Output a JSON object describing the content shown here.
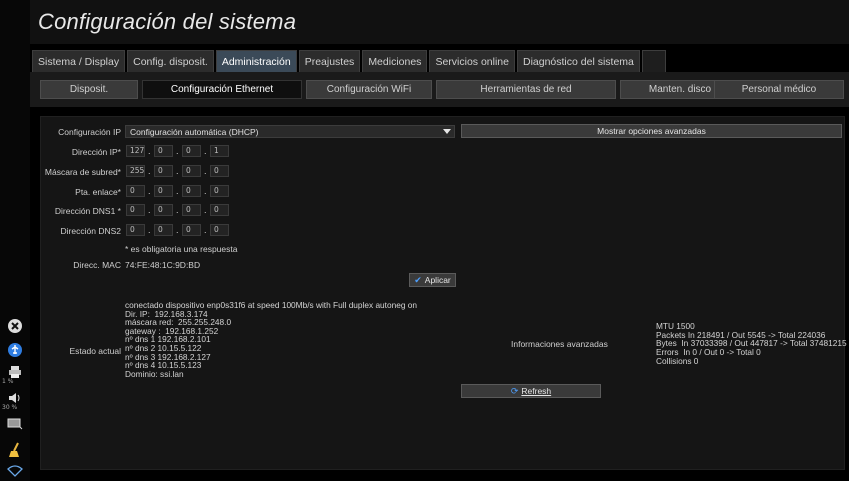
{
  "app": {
    "title": "Configuración del sistema"
  },
  "top_tabs": [
    {
      "label": "Sistema / Display",
      "active": false
    },
    {
      "label": "Config. disposit.",
      "active": false
    },
    {
      "label": "Administración",
      "active": true
    },
    {
      "label": "Preajustes",
      "active": false
    },
    {
      "label": "Mediciones",
      "active": false
    },
    {
      "label": "Servicios online",
      "active": false
    },
    {
      "label": "Diagnóstico del sistema",
      "active": false
    }
  ],
  "sub_tabs": [
    {
      "label": "Disposit.",
      "active": false
    },
    {
      "label": "Configuración Ethernet",
      "active": true
    },
    {
      "label": "Configuración WiFi",
      "active": false
    },
    {
      "label": "Herramientas de red",
      "active": false
    },
    {
      "label": "Manten. disco",
      "active": false
    },
    {
      "label": "Personal médico",
      "active": false
    }
  ],
  "form": {
    "ip_config_label": "Configuración IP",
    "ip_config_value": "Configuración automática (DHCP)",
    "advanced_button": "Mostrar opciones avanzadas",
    "ip_address_label": "Dirección IP*",
    "ip_address": [
      "127",
      "0",
      "0",
      "1"
    ],
    "subnet_label": "Máscara de subred*",
    "subnet": [
      "255",
      "0",
      "0",
      "0"
    ],
    "gateway_label": "Pta. enlace*",
    "gateway": [
      "0",
      "0",
      "0",
      "0"
    ],
    "dns1_label": "Dirección DNS1 *",
    "dns1": [
      "0",
      "0",
      "0",
      "0"
    ],
    "dns2_label": "Dirección DNS2",
    "dns2": [
      "0",
      "0",
      "0",
      "0"
    ],
    "required_note": "* es obligatoria una respuesta",
    "mac_label": "Direcc. MAC",
    "mac_value": "74:FE:48:1C:9D:BD",
    "apply_button": "Aplicar"
  },
  "status": {
    "label": "Estado actual",
    "lines": "conectado dispositivo enp0s31f6 at speed 100Mb/s with Full duplex autoneg on\nDir. IP:  192.168.3.174\nmáscara red:  255.255.248.0\ngateway :  192.168.1.252\nnº dns 1 192.168.2.101\nnº dns 2 10.15.5.122\nnº dns 3 192.168.2.127\nnº dns 4 10.15.5.123\nDominio: ssi.lan",
    "advanced_info_label": "Informaciones avanzadas",
    "stats": "MTU 1500\nPackets In 218491 / Out 5545 -> Total 224036\nBytes  In 37033398 / Out 447817 -> Total 37481215\nErrors  In 0 / Out 0 -> Total 0\nCollisions 0",
    "refresh_button": "Refresh"
  },
  "sidebar": {
    "progress_1": "1 %",
    "volume": "30 %"
  }
}
